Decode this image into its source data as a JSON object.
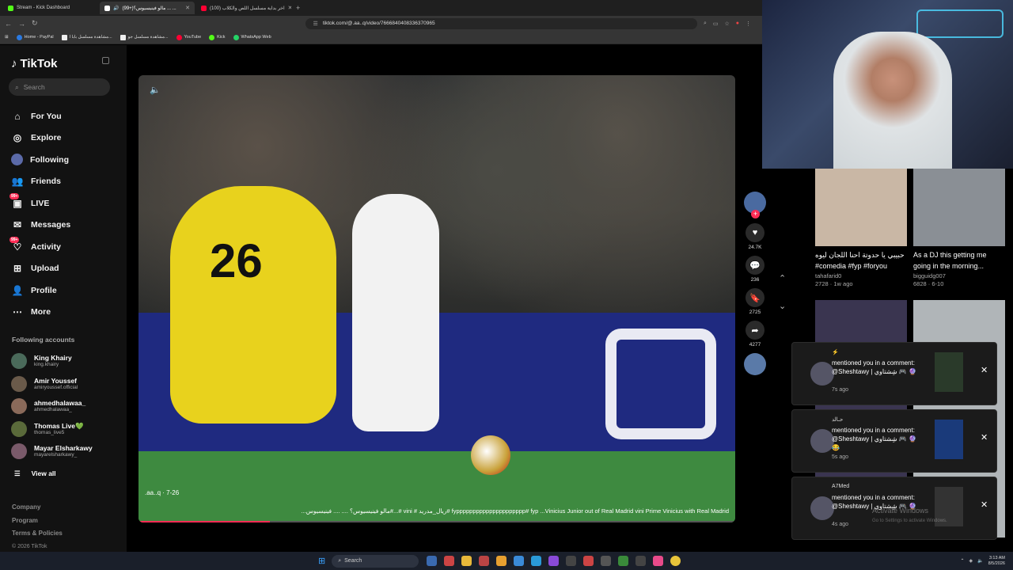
{
  "browser": {
    "tabs": [
      {
        "label": "Stream - Kick Dashboard",
        "color": "#53fc18"
      },
      {
        "label": "(99+)مالو فينيسيوس؟ ... ...",
        "color": "#ffffff"
      },
      {
        "label": "(100) اخر بداية مسلسل اللص والكلاب",
        "color": "#ff0033"
      }
    ],
    "url": "tiktok.com/@.aa..q/video/7666840408336370965",
    "bookmarks": [
      {
        "label": "Home - PayPal",
        "color": "#2a7ae2"
      },
      {
        "label": "مشاهدة مسلسل بابا ا...",
        "color": "#eeeeee"
      },
      {
        "label": "مشاهدة مسلسل جو...",
        "color": "#eeeeee"
      },
      {
        "label": "YouTube",
        "color": "#ff0033"
      },
      {
        "label": "Kick",
        "color": "#53fc18"
      },
      {
        "label": "WhatsApp Web",
        "color": "#25d366"
      }
    ]
  },
  "tiktok": {
    "logo": "TikTok",
    "search_placeholder": "Search",
    "menu": [
      {
        "label": "For You",
        "icon": "home-icon",
        "badge": ""
      },
      {
        "label": "Explore",
        "icon": "compass-icon",
        "badge": ""
      },
      {
        "label": "Following",
        "icon": "following-icon",
        "badge": ""
      },
      {
        "label": "Friends",
        "icon": "friends-icon",
        "badge": ""
      },
      {
        "label": "LIVE",
        "icon": "live-icon",
        "badge": "99+"
      },
      {
        "label": "Messages",
        "icon": "messages-icon",
        "badge": ""
      },
      {
        "label": "Activity",
        "icon": "activity-icon",
        "badge": "99+"
      },
      {
        "label": "Upload",
        "icon": "upload-icon",
        "badge": ""
      },
      {
        "label": "Profile",
        "icon": "profile-icon",
        "badge": ""
      },
      {
        "label": "More",
        "icon": "more-icon",
        "badge": ""
      }
    ],
    "following_title": "Following accounts",
    "following": [
      {
        "name": "King Khairy",
        "user": "king.khairy",
        "color": "#4a6a5a"
      },
      {
        "name": "Amir Youssef",
        "user": "amiryoussef.official",
        "color": "#6a5a4a"
      },
      {
        "name": "ahmedhalawaa_",
        "user": "ahmedhalawaa_",
        "color": "#8a6a5a"
      },
      {
        "name": "Thomas Live💚",
        "user": "thomas_live5",
        "color": "#5a6a3a"
      },
      {
        "name": "Mayar Elsharkawy",
        "user": "mayarelsharkawy_",
        "color": "#7a5a6a"
      }
    ],
    "view_all": "View all",
    "footer": [
      "Company",
      "Program",
      "Terms & Policies"
    ],
    "copyright": "© 2026 TikTok"
  },
  "video": {
    "author": ".aa..q · 7-26",
    "description": "...مالو فينيسيوس؟ .... .... فينيسيوس#...# vini # ريال_مدريد# fyppppppppppppppppppppp# fyp ...Vinicius Junior out of Real Madrid vini Prime Vinicius with Real Madrid",
    "jersey_number": "26",
    "progress": 0.22,
    "likes": "24.7K",
    "comments": "236",
    "saves": "2725",
    "shares": "4277"
  },
  "side": {
    "thumbs": [
      {
        "title": "حبيبي يا حدوتة احنا اللجان ليوه #comedia #fyp #foryou",
        "user": "tahafarid0",
        "meta": "2728 · 1w ago",
        "color": "#c9b7a5"
      },
      {
        "title": "As a DJ this getting me going in the morning...",
        "user": "bigguidg007",
        "meta": "6828 · 6-10",
        "color": "#8a8f95"
      },
      {
        "title": "",
        "user": "",
        "meta": "",
        "color": "#3a3550"
      },
      {
        "title": "",
        "user": "",
        "meta": "",
        "color": "#b0b5b8"
      }
    ],
    "notifications": [
      {
        "who": "",
        "msg": "mentioned you in a comment: @Sheshtawy | شِشتاوي 🎮 🔮",
        "ago": "7s ago"
      },
      {
        "who": "حـالد",
        "msg": "mentioned you in a comment: @Sheshtawy | شِشتاوي 🎮 🔮 😂",
        "ago": "5s ago"
      },
      {
        "who": "A7Med",
        "msg": "mentioned you in a comment: @Sheshtawy | شِشتاوي 🎮 🔮",
        "ago": "4s ago"
      }
    ],
    "activate": "Activate Windows",
    "activate_sub": "Go to Settings to activate Windows."
  },
  "taskbar": {
    "search": "Search",
    "time": "3:13 AM",
    "date": "8/5/2026"
  }
}
